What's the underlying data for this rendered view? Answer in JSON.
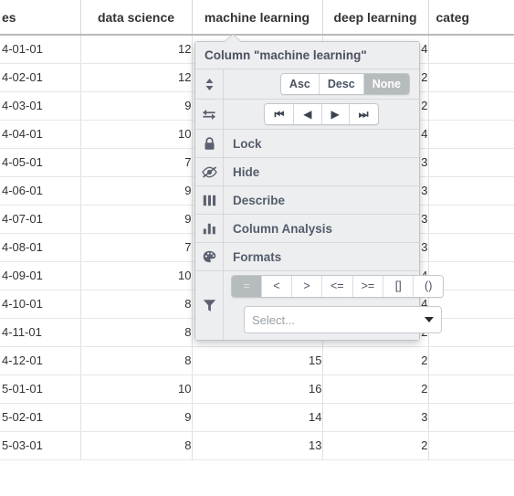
{
  "table": {
    "columns": [
      {
        "key": "dates",
        "label": "es",
        "align": "left"
      },
      {
        "key": "data_science",
        "label": "data science",
        "align": "right"
      },
      {
        "key": "machine_learning",
        "label": "machine learning",
        "align": "right"
      },
      {
        "key": "deep_learning",
        "label": "deep learning",
        "align": "right"
      },
      {
        "key": "category",
        "label": "categ",
        "align": "left"
      }
    ],
    "rows": [
      {
        "dates": "4-01-01",
        "data_science": "12",
        "machine_learning": "",
        "deep_learning": "4",
        "category": ""
      },
      {
        "dates": "4-02-01",
        "data_science": "12",
        "machine_learning": "",
        "deep_learning": "2",
        "category": ""
      },
      {
        "dates": "4-03-01",
        "data_science": "9",
        "machine_learning": "",
        "deep_learning": "2",
        "category": ""
      },
      {
        "dates": "4-04-01",
        "data_science": "10",
        "machine_learning": "",
        "deep_learning": "4",
        "category": ""
      },
      {
        "dates": "4-05-01",
        "data_science": "7",
        "machine_learning": "",
        "deep_learning": "3",
        "category": ""
      },
      {
        "dates": "4-06-01",
        "data_science": "9",
        "machine_learning": "",
        "deep_learning": "3",
        "category": ""
      },
      {
        "dates": "4-07-01",
        "data_science": "9",
        "machine_learning": "",
        "deep_learning": "3",
        "category": ""
      },
      {
        "dates": "4-08-01",
        "data_science": "7",
        "machine_learning": "",
        "deep_learning": "3",
        "category": ""
      },
      {
        "dates": "4-09-01",
        "data_science": "10",
        "machine_learning": "",
        "deep_learning": "4",
        "category": ""
      },
      {
        "dates": "4-10-01",
        "data_science": "8",
        "machine_learning": "",
        "deep_learning": "4",
        "category": ""
      },
      {
        "dates": "4-11-01",
        "data_science": "8",
        "machine_learning": "",
        "deep_learning": "2",
        "category": ""
      },
      {
        "dates": "4-12-01",
        "data_science": "8",
        "machine_learning": "15",
        "deep_learning": "2",
        "category": ""
      },
      {
        "dates": "5-01-01",
        "data_science": "10",
        "machine_learning": "16",
        "deep_learning": "2",
        "category": ""
      },
      {
        "dates": "5-02-01",
        "data_science": "9",
        "machine_learning": "14",
        "deep_learning": "3",
        "category": ""
      },
      {
        "dates": "5-03-01",
        "data_science": "8",
        "machine_learning": "13",
        "deep_learning": "2",
        "category": ""
      }
    ]
  },
  "popup": {
    "title": "Column \"machine learning\"",
    "sort": {
      "icon": "sort-icon",
      "options": [
        {
          "label": "Asc",
          "active": false
        },
        {
          "label": "Desc",
          "active": false
        },
        {
          "label": "None",
          "active": true
        }
      ]
    },
    "move": {
      "icon": "move-horizontal-icon",
      "buttons": [
        {
          "name": "move-first-button",
          "glyph": "⏮"
        },
        {
          "name": "move-left-button",
          "glyph": "◀"
        },
        {
          "name": "move-right-button",
          "glyph": "▶"
        },
        {
          "name": "move-last-button",
          "glyph": "⏭"
        }
      ]
    },
    "items": [
      {
        "icon": "lock-icon",
        "label": "Lock"
      },
      {
        "icon": "eye-slash-icon",
        "label": "Hide"
      },
      {
        "icon": "columns-icon",
        "label": "Describe"
      },
      {
        "icon": "bar-chart-icon",
        "label": "Column Analysis"
      },
      {
        "icon": "palette-icon",
        "label": "Formats"
      }
    ],
    "filter": {
      "icon": "funnel-icon",
      "operators": [
        {
          "label": "=",
          "active": true
        },
        {
          "label": "<",
          "active": false
        },
        {
          "label": ">",
          "active": false
        },
        {
          "label": "<=",
          "active": false
        },
        {
          "label": ">=",
          "active": false
        },
        {
          "label": "[]",
          "active": false
        },
        {
          "label": "()",
          "active": false
        }
      ],
      "select_placeholder": "Select..."
    }
  },
  "colors": {
    "popup_bg": "#eceef0",
    "popup_border": "#bfc4c9",
    "active_btn": "#b6bcbd",
    "header_text": "#333333",
    "label_text": "#555d6b"
  }
}
